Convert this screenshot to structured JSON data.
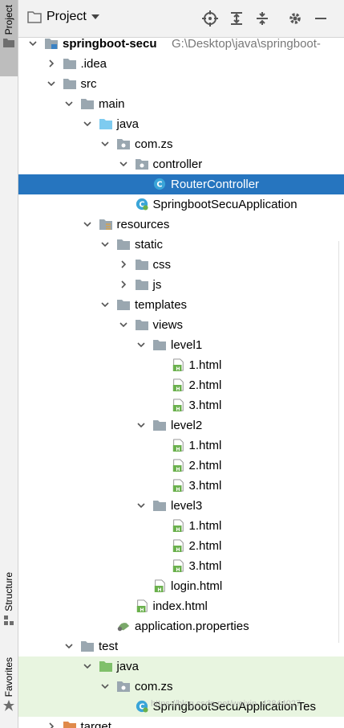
{
  "sidebar": {
    "project_tab": "Project",
    "structure_tab": "Structure",
    "favorites_tab": "Favorites"
  },
  "header": {
    "title": "Project"
  },
  "tree": [
    {
      "depth": 0,
      "arrow": "down",
      "icon": "module",
      "label": "springboot-secu",
      "bold": true,
      "path": "G:\\Desktop\\java\\springboot-"
    },
    {
      "depth": 1,
      "arrow": "right",
      "icon": "folder",
      "label": ".idea"
    },
    {
      "depth": 1,
      "arrow": "down",
      "icon": "folder",
      "label": "src"
    },
    {
      "depth": 2,
      "arrow": "down",
      "icon": "folder",
      "label": "main"
    },
    {
      "depth": 3,
      "arrow": "down",
      "icon": "folder-blue",
      "label": "java"
    },
    {
      "depth": 4,
      "arrow": "down",
      "icon": "package",
      "label": "com.zs"
    },
    {
      "depth": 5,
      "arrow": "down",
      "icon": "package",
      "label": "controller"
    },
    {
      "depth": 6,
      "arrow": "none",
      "icon": "class",
      "label": "RouterController",
      "selected": true
    },
    {
      "depth": 5,
      "arrow": "none",
      "icon": "spring-class",
      "label": "SpringbootSecuApplication"
    },
    {
      "depth": 3,
      "arrow": "down",
      "icon": "resources",
      "label": "resources"
    },
    {
      "depth": 4,
      "arrow": "down",
      "icon": "folder",
      "label": "static"
    },
    {
      "depth": 5,
      "arrow": "right",
      "icon": "folder",
      "label": "css"
    },
    {
      "depth": 5,
      "arrow": "right",
      "icon": "folder",
      "label": "js"
    },
    {
      "depth": 4,
      "arrow": "down",
      "icon": "folder",
      "label": "templates"
    },
    {
      "depth": 5,
      "arrow": "down",
      "icon": "folder",
      "label": "views"
    },
    {
      "depth": 6,
      "arrow": "down",
      "icon": "folder",
      "label": "level1"
    },
    {
      "depth": 7,
      "arrow": "none",
      "icon": "html",
      "label": "1.html"
    },
    {
      "depth": 7,
      "arrow": "none",
      "icon": "html",
      "label": "2.html"
    },
    {
      "depth": 7,
      "arrow": "none",
      "icon": "html",
      "label": "3.html"
    },
    {
      "depth": 6,
      "arrow": "down",
      "icon": "folder",
      "label": "level2"
    },
    {
      "depth": 7,
      "arrow": "none",
      "icon": "html",
      "label": "1.html"
    },
    {
      "depth": 7,
      "arrow": "none",
      "icon": "html",
      "label": "2.html"
    },
    {
      "depth": 7,
      "arrow": "none",
      "icon": "html",
      "label": "3.html"
    },
    {
      "depth": 6,
      "arrow": "down",
      "icon": "folder",
      "label": "level3"
    },
    {
      "depth": 7,
      "arrow": "none",
      "icon": "html",
      "label": "1.html"
    },
    {
      "depth": 7,
      "arrow": "none",
      "icon": "html",
      "label": "2.html"
    },
    {
      "depth": 7,
      "arrow": "none",
      "icon": "html",
      "label": "3.html"
    },
    {
      "depth": 6,
      "arrow": "none",
      "icon": "html",
      "label": "login.html"
    },
    {
      "depth": 5,
      "arrow": "none",
      "icon": "html",
      "label": "index.html"
    },
    {
      "depth": 4,
      "arrow": "none",
      "icon": "properties",
      "label": "application.properties"
    },
    {
      "depth": 2,
      "arrow": "down",
      "icon": "folder",
      "label": "test"
    },
    {
      "depth": 3,
      "arrow": "down",
      "icon": "folder-green",
      "label": "java",
      "test": true
    },
    {
      "depth": 4,
      "arrow": "down",
      "icon": "package",
      "label": "com.zs",
      "test": true
    },
    {
      "depth": 5,
      "arrow": "none",
      "icon": "spring-class",
      "label": "SpringbootSecuApplicationTes",
      "test": true
    },
    {
      "depth": 1,
      "arrow": "right",
      "icon": "folder-orange",
      "label": "target"
    }
  ],
  "watermark": "https://blog.csdn.net/weixin_43844027",
  "colors": {
    "selection": "#2675bf",
    "test_bg": "#e8f5e0",
    "folder": "#9aa7b0",
    "folder_blue": "#7ecbf0",
    "folder_green": "#7fc06a",
    "html_green": "#6ab04c",
    "class_blue": "#3aa5d8"
  }
}
